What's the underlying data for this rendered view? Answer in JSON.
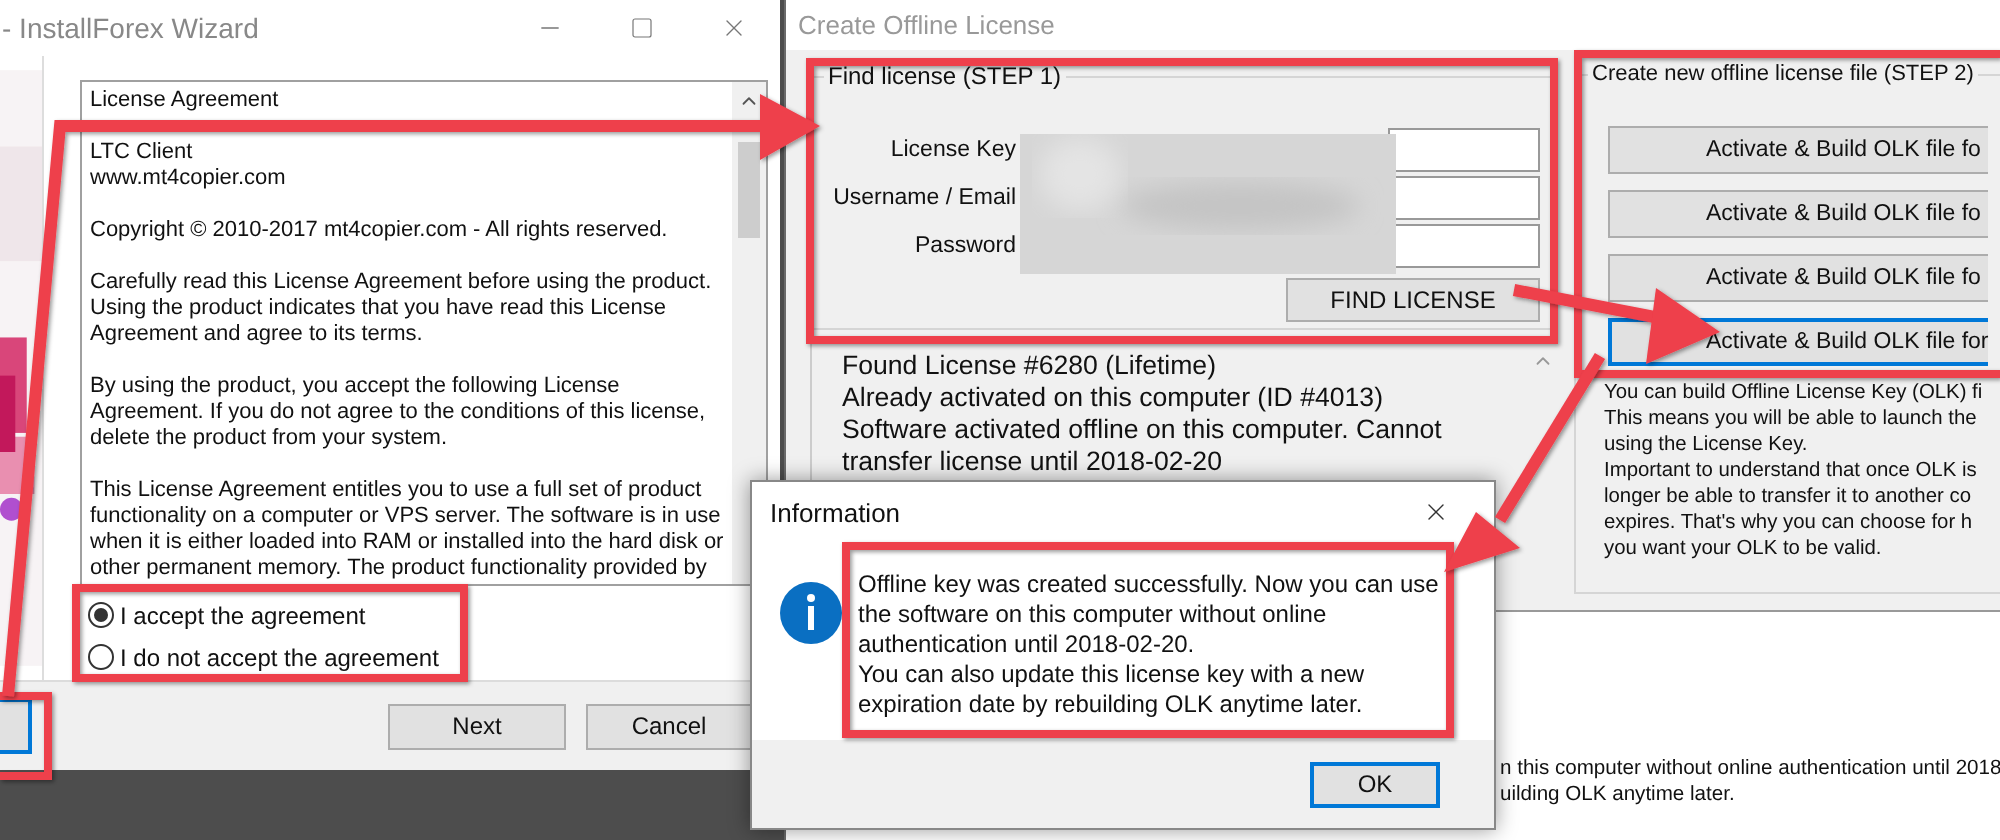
{
  "wizard": {
    "title": "- InstallForex Wizard",
    "license_paragraphs": [
      [
        "License Agreement"
      ],
      [
        "LTC Client",
        "www.mt4copier.com"
      ],
      [
        "Copyright © 2010-2017 mt4copier.com - All rights reserved."
      ],
      [
        "Carefully read this License Agreement before using the product.",
        "Using the product indicates that you have read this License",
        "Agreement and agree to its terms."
      ],
      [
        "By using the product, you accept the following License",
        "Agreement. If you do not agree to the conditions of this license,",
        "delete the product from your system."
      ],
      [
        "This License Agreement entitles you to use a full set of product",
        "functionality on a computer or VPS server. The software is in use",
        "when it is either loaded into RAM or installed into the hard disk or",
        "other permanent memory. The product functionality provided by"
      ]
    ],
    "agreement_options": [
      {
        "label": "I accept the agreement",
        "selected": true
      },
      {
        "label": "I do not accept the agreement",
        "selected": false
      }
    ],
    "back_button": {
      "focused": true
    },
    "buttons": [
      {
        "label": "Next"
      },
      {
        "label": "Cancel"
      }
    ]
  },
  "offline_window": {
    "title": "Create Offline License",
    "find_license": {
      "title": "Find license (STEP 1)",
      "fields": [
        {
          "label": "License Key"
        },
        {
          "label": "Username / Email"
        },
        {
          "label": "Password"
        }
      ],
      "button": "FIND LICENSE"
    },
    "status_lines": [
      "Found License #6280 (Lifetime)",
      "Already activated on this computer (ID #4013)",
      "Software activated offline on this computer. Cannot transfer license until 2018-02-20"
    ],
    "build_file": {
      "title": "Create new offline license file (STEP 2)",
      "buttons": [
        {
          "label": "Activate & Build OLK file fo",
          "focused": false
        },
        {
          "label": "Activate & Build OLK file fo",
          "focused": false
        },
        {
          "label": "Activate & Build OLK file fo",
          "focused": false
        },
        {
          "label": "Activate & Build OLK file for",
          "focused": true
        }
      ],
      "description_lines": [
        "You can build Offline License Key (OLK) fi",
        "This means you will be able to launch the",
        "using the License Key.",
        "Important to understand that once OLK is",
        "longer be able to transfer it to another co",
        "expires. That's why you can choose for h",
        "you want your OLK to be valid."
      ]
    },
    "log_lines": [
      "n this computer without online authentication until 2018",
      "uilding OLK anytime later."
    ]
  },
  "info_dialog": {
    "title": "Information",
    "message_paragraphs": [
      "Offline key was created successfully. Now you can use the software on this computer without online authentication until 2018-02-20.",
      "You can also update this license key with a new expiration date by rebuilding OLK anytime later."
    ],
    "button": {
      "label": "OK",
      "focused": true
    }
  }
}
